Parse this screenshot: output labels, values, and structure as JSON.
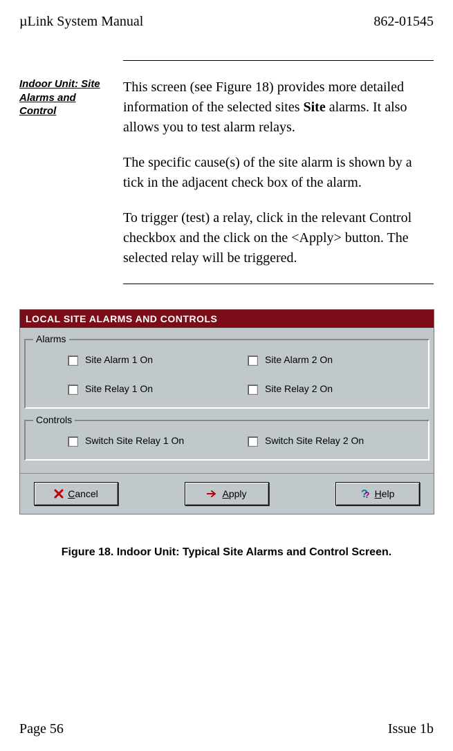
{
  "header": {
    "left": "µLink System Manual",
    "right": "862-01545"
  },
  "margin_note": "Indoor Unit: Site Alarms and Control",
  "body": {
    "p1_a": "This screen (see Figure 18) provides more detailed information of the selected sites ",
    "p1_bold": "Site",
    "p1_b": " alarms.  It also allows you to test alarm relays.",
    "p2": "The specific cause(s) of the site alarm is shown by a tick in the adjacent check box of the alarm.",
    "p3": "To trigger (test) a relay, click in the relevant Control checkbox and the click on the <Apply> button.  The selected relay will be triggered."
  },
  "panel": {
    "title": "LOCAL SITE ALARMS AND CONTROLS",
    "group_alarms": "Alarms",
    "alarm1": "Site Alarm 1 On",
    "alarm2": "Site Alarm 2 On",
    "relay1": "Site Relay 1 On",
    "relay2": "Site Relay 2 On",
    "group_controls": "Controls",
    "switch1": "Switch Site Relay 1 On",
    "switch2": "Switch Site Relay 2 On",
    "buttons": {
      "cancel_u": "C",
      "cancel_rest": "ancel",
      "apply_u": "A",
      "apply_rest": "pply",
      "help_u": "H",
      "help_rest": "elp"
    }
  },
  "caption": "Figure 18.  Indoor Unit:  Typical Site Alarms and Control Screen.",
  "footer": {
    "left": "Page 56",
    "right": "Issue 1b"
  }
}
